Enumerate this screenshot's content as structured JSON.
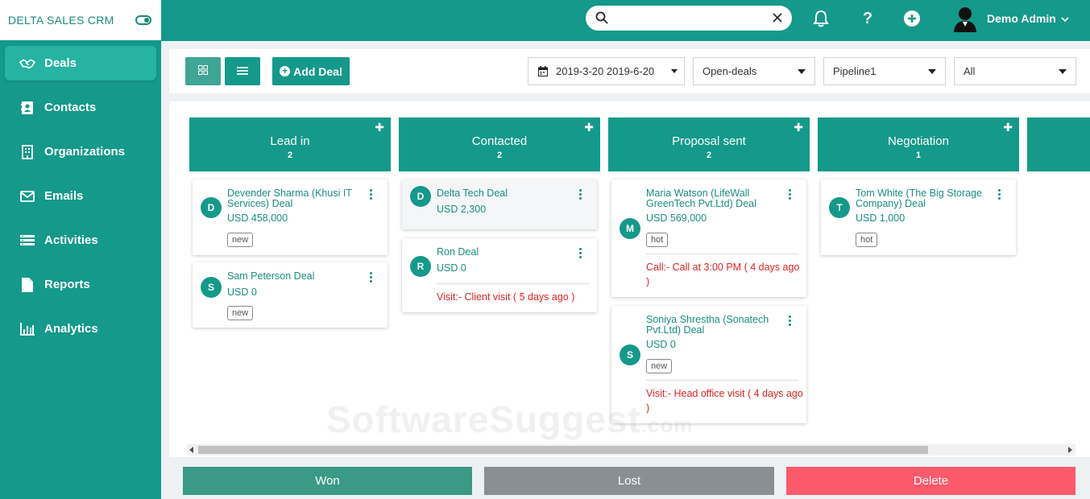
{
  "app": {
    "brand": "DELTA SALES CRM"
  },
  "sidebar": {
    "items": [
      {
        "label": "Deals",
        "icon": "handshake-icon",
        "active": true
      },
      {
        "label": "Contacts",
        "icon": "contact-card-icon"
      },
      {
        "label": "Organizations",
        "icon": "building-icon"
      },
      {
        "label": "Emails",
        "icon": "envelope-icon"
      },
      {
        "label": "Activities",
        "icon": "list-icon"
      },
      {
        "label": "Reports",
        "icon": "document-icon"
      },
      {
        "label": "Analytics",
        "icon": "bar-chart-icon"
      }
    ]
  },
  "header": {
    "search": {
      "value": "",
      "placeholder": ""
    },
    "user": {
      "name": "Demo Admin"
    }
  },
  "toolbar": {
    "add_deal_label": "Add Deal",
    "date_range": "2019-3-20 2019-6-20",
    "status_filter": "Open-deals",
    "pipeline": "Pipeline1",
    "owner_filter": "All"
  },
  "columns": [
    {
      "title": "Lead in",
      "count": "2",
      "deals": [
        {
          "initial": "D",
          "name": "Devender Sharma (Khusi IT Services) Deal",
          "amount": "USD 458,000",
          "tag": "new"
        },
        {
          "initial": "S",
          "name": "Sam Peterson Deal",
          "amount": "USD 0",
          "tag": "new"
        }
      ]
    },
    {
      "title": "Contacted",
      "count": "2",
      "deals": [
        {
          "initial": "D",
          "name": "Delta Tech Deal",
          "amount": "USD 2,300"
        },
        {
          "initial": "R",
          "name": "Ron Deal",
          "amount": "USD 0",
          "activity": "Visit:- Client visit ( 5 days ago )"
        }
      ]
    },
    {
      "title": "Proposal sent",
      "count": "2",
      "deals": [
        {
          "initial": "M",
          "name": "Maria Watson (LifeWall GreenTech Pvt.Ltd) Deal",
          "amount": "USD 569,000",
          "tag": "hot",
          "activity": "Call:- Call at 3:00 PM ( 4 days ago )"
        },
        {
          "initial": "S",
          "name": "Soniya Shrestha (Sonatech Pvt.Ltd) Deal",
          "amount": "USD 0",
          "tag": "new",
          "activity": "Visit:- Head office visit ( 4 days ago )"
        }
      ]
    },
    {
      "title": "Negotiation",
      "count": "1",
      "deals": [
        {
          "initial": "T",
          "name": "Tom White (The Big Storage Company) Deal",
          "amount": "USD 1,000",
          "tag": "hot"
        }
      ]
    }
  ],
  "footer": {
    "won_label": "Won",
    "lost_label": "Lost",
    "delete_label": "Delete"
  },
  "watermark": {
    "text": "SoftwareSuggest",
    "suffix": ".com"
  },
  "colors": {
    "primary": "#14998a",
    "won": "#3a9a86",
    "lost": "#8a8f94",
    "delete": "#fc5a6b",
    "activity": "#e02424"
  }
}
